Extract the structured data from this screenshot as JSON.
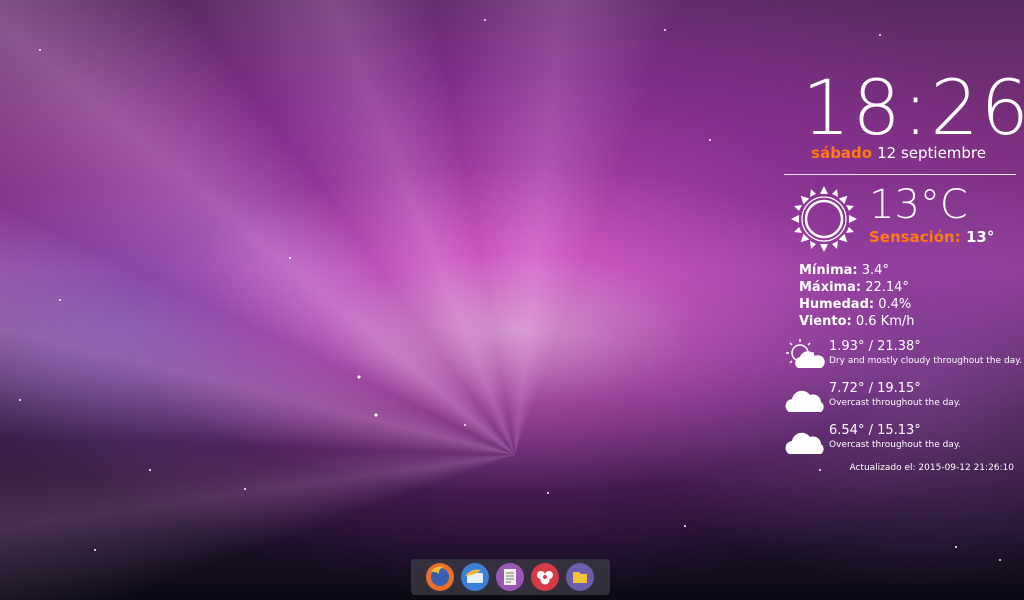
{
  "clock": {
    "time": "18:26",
    "weekday": "sábado",
    "date": "12 septiembre"
  },
  "weather": {
    "current_temp": "13°C",
    "feels_label": "Sensación:",
    "feels_value": "13°",
    "stats": [
      {
        "label": "Mínima:",
        "value": "3.4°"
      },
      {
        "label": "Máxima:",
        "value": "22.14°"
      },
      {
        "label": "Humedad:",
        "value": "0.4%"
      },
      {
        "label": "Viento:",
        "value": "0.6 Km/h"
      }
    ],
    "forecast": [
      {
        "icon": "partly-cloudy-icon",
        "temps": "1.93° / 21.38°",
        "summary": "Dry and mostly cloudy throughout the day."
      },
      {
        "icon": "cloud-icon",
        "temps": "7.72° / 19.15°",
        "summary": "Overcast throughout the day."
      },
      {
        "icon": "cloud-icon",
        "temps": "6.54° / 15.13°",
        "summary": "Overcast throughout the day."
      }
    ],
    "updated": "Actualizado el: 2015-09-12 21:26:10"
  },
  "dock": {
    "items": [
      {
        "name": "firefox-icon",
        "color": "#e8702a"
      },
      {
        "name": "thunderbird-icon",
        "color": "#3b7fd6"
      },
      {
        "name": "text-editor-icon",
        "color": "#9b57b5"
      },
      {
        "name": "app-store-icon",
        "color": "#d93a4a"
      },
      {
        "name": "files-icon",
        "color": "#6a5fa8"
      }
    ]
  },
  "colors": {
    "accent": "#ff7a14",
    "text": "#ffffff"
  }
}
